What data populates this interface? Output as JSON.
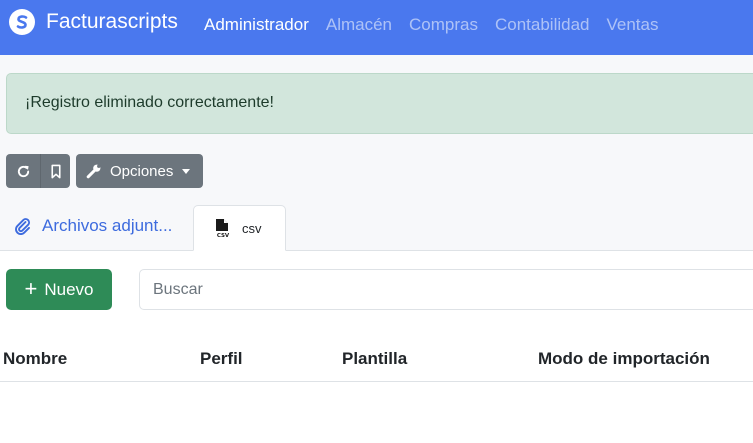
{
  "navbar": {
    "brand": "Facturascripts",
    "items": [
      {
        "label": "Administrador",
        "active": true
      },
      {
        "label": "Almacén",
        "active": false
      },
      {
        "label": "Compras",
        "active": false
      },
      {
        "label": "Contabilidad",
        "active": false
      },
      {
        "label": "Ventas",
        "active": false
      }
    ]
  },
  "alert": {
    "message": "¡Registro eliminado correctamente!"
  },
  "toolbar": {
    "reload_icon": "reload-icon",
    "bookmark_icon": "bookmark-icon",
    "options_label": "Opciones"
  },
  "tabs": [
    {
      "label": "Archivos adjunt...",
      "icon": "paperclip-icon",
      "active": false
    },
    {
      "label": "csv",
      "icon": "csv-file-icon",
      "active": true
    }
  ],
  "list": {
    "new_label": "Nuevo",
    "search_placeholder": "Buscar",
    "columns": [
      "Nombre",
      "Perfil",
      "Plantilla",
      "Modo de importación"
    ]
  },
  "colors": {
    "navbar": "#4a78ee",
    "alert_bg": "#d2e6dc",
    "secondary_button": "#6c757d",
    "success_button": "#2e8b57",
    "link": "#3d6bde"
  }
}
